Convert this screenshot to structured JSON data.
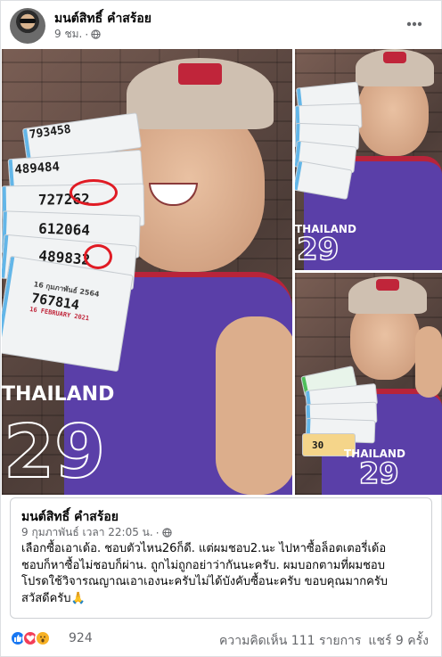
{
  "post": {
    "author": "มนต์สิทธิ์ คำสร้อย",
    "time": "9 ชม.",
    "separator": "·"
  },
  "photos": {
    "main_tickets": [
      "793458",
      "489484",
      "727262",
      "612064",
      "489832",
      "767814"
    ],
    "main_ticket_date": "16 กุมภาพันธ์ 2564",
    "main_ticket_date_en": "16 FEBRUARY 2021",
    "jersey_text": "THAILAND",
    "jersey_number": "29",
    "small_ticket_label": "30"
  },
  "shared": {
    "author": "มนต์สิทธิ์ คำสร้อย",
    "date": "9 กุมภาพันธ์ เวลา 22:05 น.",
    "separator": "·",
    "lines": [
      "เลือกซื้อเอาเด้อ. ชอบตัวไหน26ก็ดี. แต่ผมชอบ2.นะ ไปหาซื้อล็อตเตอรี่เด้อ",
      "ชอบก็หาซื้อไม่ชอบก็ผ่าน. ถูกไม่ถูกอย่าว่ากันนะครับ. ผมบอกตามที่ผมชอบ",
      "โปรดใช้วิจารณญาณเอาเองนะครับไม่ได้บังคับซื้อนะครับ ขอบคุณมากครับ",
      "สวัสดีครับ🙏"
    ]
  },
  "footer": {
    "reaction_count": "924",
    "comments": "ความคิดเห็น 111 รายการ",
    "shares": "แชร์ 9 ครั้ง"
  },
  "colors": {
    "text_primary": "#050505",
    "text_secondary": "#65676b",
    "like_blue": "#1877f2",
    "love_red": "#f33e58",
    "wow_yellow": "#f7b125",
    "circle_red": "#e01b24"
  },
  "icons": {
    "globe": "globe-icon",
    "more": "more-dots-icon",
    "like": "like-icon",
    "love": "love-icon",
    "wow": "wow-icon"
  }
}
